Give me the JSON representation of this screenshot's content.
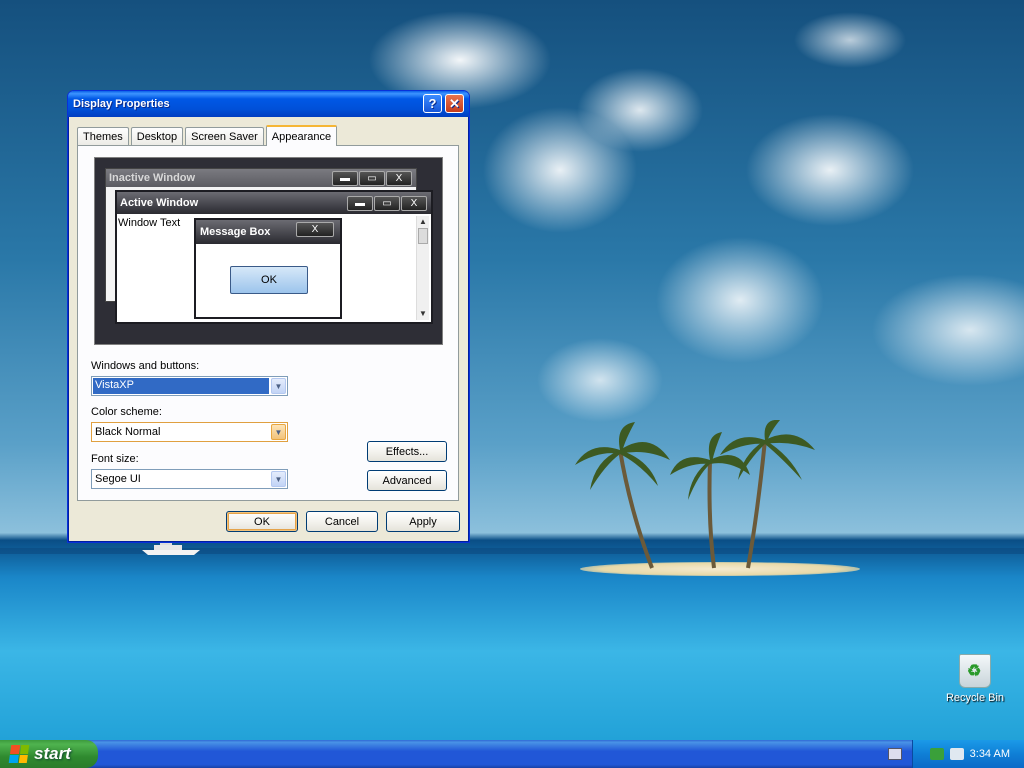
{
  "window": {
    "title": "Display Properties",
    "help_label": "?",
    "close_label": "✕"
  },
  "tabs": [
    {
      "label": "Themes"
    },
    {
      "label": "Desktop"
    },
    {
      "label": "Screen Saver"
    },
    {
      "label": "Appearance",
      "active": true
    }
  ],
  "preview": {
    "inactive_title": "Inactive Window",
    "active_title": "Active Window",
    "window_text": "Window Text",
    "message_title": "Message Box",
    "message_ok": "OK",
    "minimize_glyph": "▬",
    "maximize_glyph": "▭",
    "close_glyph": "X"
  },
  "form": {
    "windows_buttons_label": "Windows and buttons:",
    "windows_buttons_value": "VistaXP",
    "color_scheme_label": "Color scheme:",
    "color_scheme_value": "Black Normal",
    "font_size_label": "Font size:",
    "font_size_value": "Segoe UI",
    "dropdown_glyph": "▼",
    "effects_label": "Effects...",
    "advanced_label": "Advanced"
  },
  "buttons": {
    "ok": "OK",
    "cancel": "Cancel",
    "apply": "Apply"
  },
  "desktop": {
    "recycle_bin": "Recycle Bin"
  },
  "taskbar": {
    "start_label": "start",
    "clock": "3:34 AM"
  },
  "colors": {
    "titlebar_blue": "#0058e6",
    "taskbar_blue": "#2157d7",
    "start_green": "#3c9a3c",
    "dialog_bg": "#ece9d8",
    "selection": "#316ac5"
  }
}
